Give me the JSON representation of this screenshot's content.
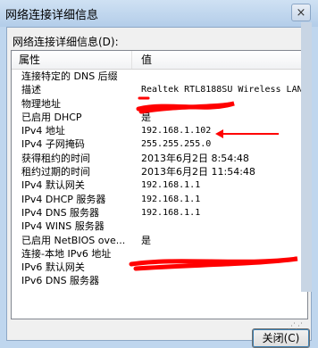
{
  "window": {
    "title": "网络连接详细信息",
    "close_glyph": "×"
  },
  "dialog": {
    "details_label": "网络连接详细信息(D):"
  },
  "table": {
    "columns": {
      "property": "属性",
      "value": "值"
    },
    "rows": [
      {
        "property": "连接特定的 DNS 后缀",
        "value": ""
      },
      {
        "property": "描述",
        "value": "Realtek RTL8188SU Wireless LAN"
      },
      {
        "property": "物理地址",
        "value": ""
      },
      {
        "property": "已启用 DHCP",
        "value": "是"
      },
      {
        "property": "IPv4 地址",
        "value": "192.168.1.102"
      },
      {
        "property": "IPv4 子网掩码",
        "value": "255.255.255.0"
      },
      {
        "property": "获得租约的时间",
        "value": "2013年6月2日 8:54:48"
      },
      {
        "property": "租约过期的时间",
        "value": "2013年6月2日 11:54:48"
      },
      {
        "property": "IPv4 默认网关",
        "value": "192.168.1.1"
      },
      {
        "property": "IPv4 DHCP 服务器",
        "value": "192.168.1.1"
      },
      {
        "property": "IPv4 DNS 服务器",
        "value": "192.168.1.1"
      },
      {
        "property": "IPv4 WINS 服务器",
        "value": ""
      },
      {
        "property": "已启用 NetBIOS ove...",
        "value": "是"
      },
      {
        "property": "连接-本地 IPv6 地址",
        "value": ""
      },
      {
        "property": "IPv6 默认网关",
        "value": ""
      },
      {
        "property": "IPv6 DNS 服务器",
        "value": ""
      }
    ]
  },
  "buttons": {
    "close_label": "关闭(C)"
  },
  "annotation": {
    "color": "#ff0000"
  }
}
